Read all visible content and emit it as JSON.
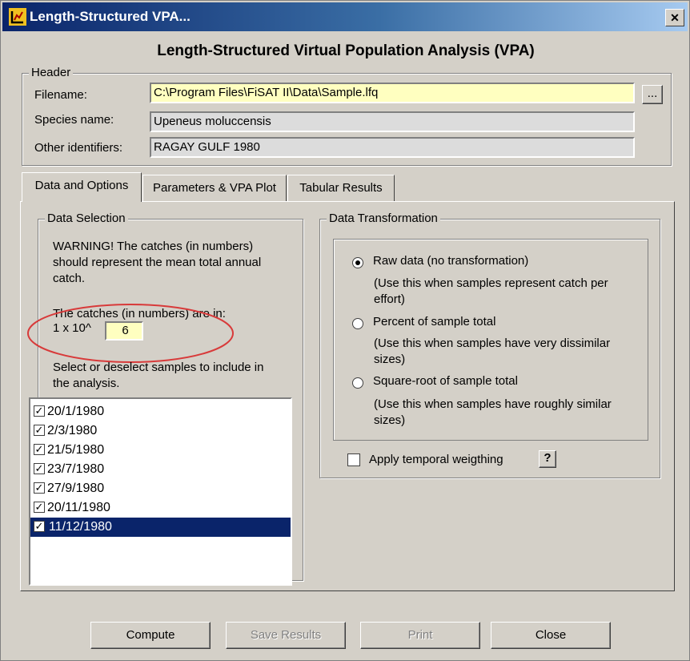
{
  "window": {
    "title": "Length-Structured VPA...",
    "close_symbol": "✕",
    "heading": "Length-Structured Virtual Population Analysis (VPA)"
  },
  "header": {
    "legend": "Header",
    "filename_label": "Filename:",
    "filename_value": "C:\\Program Files\\FiSAT II\\Data\\Sample.lfq",
    "browse_label": "...",
    "species_label": "Species name:",
    "species_value": "Upeneus moluccensis",
    "other_label": "Other identifiers:",
    "other_value": "RAGAY GULF 1980"
  },
  "tabs": [
    {
      "label": "Data and Options",
      "active": true
    },
    {
      "label": "Parameters & VPA Plot",
      "active": false
    },
    {
      "label": "Tabular Results",
      "active": false
    }
  ],
  "data_selection": {
    "legend": "Data Selection",
    "warning_lines": [
      "WARNING! The catches (in numbers)",
      "should represent the mean total annual",
      "catch."
    ],
    "catches_label": "The catches (in numbers) are in:",
    "multiplier_prefix": "1 x 10^",
    "exponent_value": "6",
    "select_lines": [
      "Select or deselect samples to include in",
      "the analysis."
    ],
    "samples": [
      {
        "date": "20/1/1980",
        "checked": true
      },
      {
        "date": "2/3/1980",
        "checked": true
      },
      {
        "date": "21/5/1980",
        "checked": true
      },
      {
        "date": "23/7/1980",
        "checked": true
      },
      {
        "date": "27/9/1980",
        "checked": true
      },
      {
        "date": "20/11/1980",
        "checked": true
      },
      {
        "date": "11/12/1980",
        "checked": true,
        "selected": true
      }
    ]
  },
  "data_transformation": {
    "legend": "Data Transformation",
    "options": [
      {
        "label": "Raw data (no transformation)",
        "hint_lines": [
          "(Use this when samples represent catch per",
          "effort)"
        ],
        "selected": true
      },
      {
        "label": "Percent of sample total",
        "hint_lines": [
          "(Use this when samples have very dissimilar",
          "sizes)"
        ],
        "selected": false
      },
      {
        "label": "Square-root of sample total",
        "hint_lines": [
          "(Use this when samples have roughly similar",
          "sizes)"
        ],
        "selected": false
      }
    ],
    "temporal_label": "Apply temporal weigthing",
    "help_label": "?"
  },
  "buttons": {
    "compute": "Compute",
    "save": "Save Results",
    "print": "Print",
    "close": "Close"
  },
  "colors": {
    "titlebar": "#0a246a",
    "face": "#d4d0c8",
    "filename_highlight": "#ffffc0",
    "annotation_circle": "#d83a3a"
  }
}
